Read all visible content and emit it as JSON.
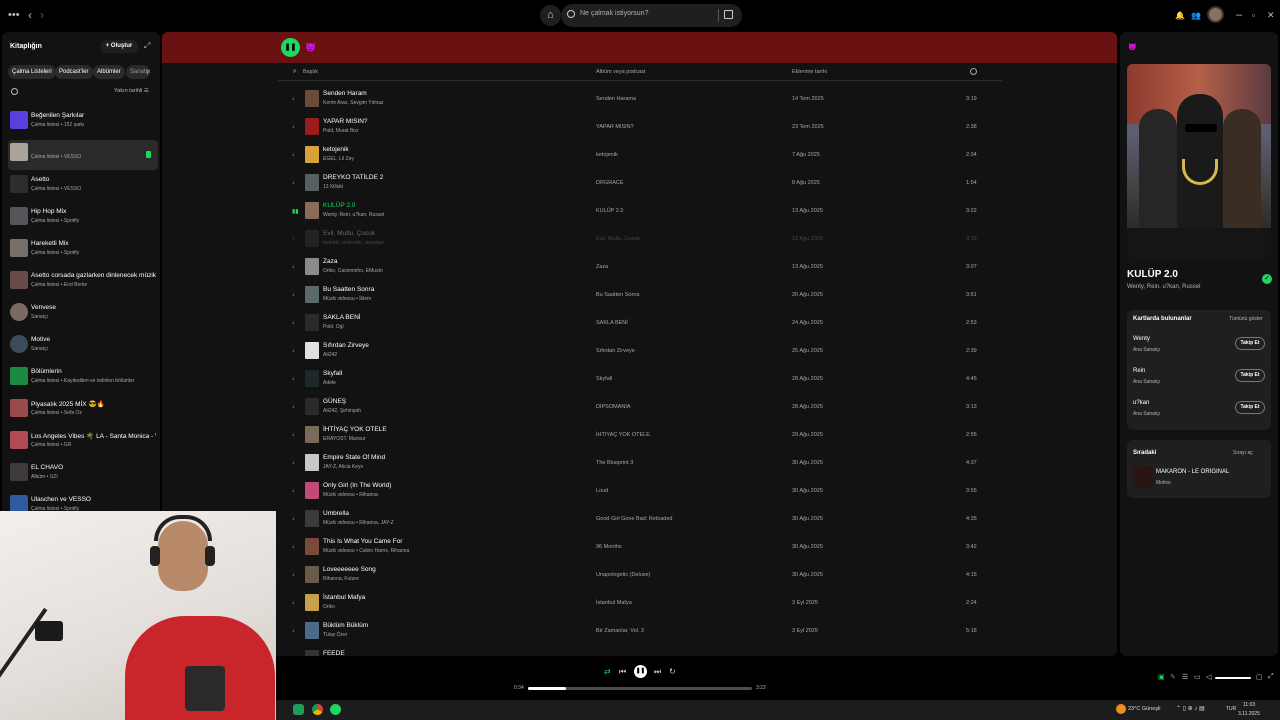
{
  "window": {
    "search_placeholder": "Ne çalmak istiyorsun?"
  },
  "colors": {
    "accent": "#1ed760",
    "header_bg": "#6a1111",
    "panel_bg": "#121212"
  },
  "library": {
    "title": "Kitaplığın",
    "create_label": "Oluştur",
    "filters": [
      "Çalma Listeleri",
      "Podcast'ler",
      "Albümler",
      "Sanatçılar"
    ],
    "sort_label": "Yakın tarihli",
    "items": [
      {
        "name": "Beğenilen Şarkılar",
        "sub": "Çalma listesi • 152 şarkı",
        "color": "#5a3ee0"
      },
      {
        "name": "",
        "sub": "Çalma listesi • VESSO",
        "color": "#a9a39c"
      },
      {
        "name": "Asetto",
        "sub": "Çalma listesi • VESSO",
        "color": "#2d2d2d"
      },
      {
        "name": "Hip Hop Mix",
        "sub": "Çalma listesi • Spotify",
        "color": "#55555a"
      },
      {
        "name": "Hareketli Mix",
        "sub": "Çalma listesi • Spotify",
        "color": "#77706a"
      },
      {
        "name": "Asetto corsada gazlarken dinlenecek müzik...",
        "sub": "Çalma listesi • Erol Berke",
        "color": "#6a4b4b"
      },
      {
        "name": "Venvese",
        "sub": "Sanatçı",
        "color": "#7a6a60"
      },
      {
        "name": "Motive",
        "sub": "Sanatçı",
        "color": "#3b4b5a"
      },
      {
        "name": "Bölümlerin",
        "sub": "Çalma listesi • Kaydedilen ve indirilen bölümler",
        "color": "#1d8a44"
      },
      {
        "name": "Piyasalık 2025 MİX 😎🔥",
        "sub": "Çalma listesi • Sefa Öz",
        "color": "#9a4a4a"
      },
      {
        "name": "Los Angeles Vibes 🌴 LA - Santa Monica - V...",
        "sub": "Çalma listesi • GR",
        "color": "#b04a55"
      },
      {
        "name": "EL CHAVO",
        "sub": "Albüm • UZI",
        "color": "#3e3a3a"
      },
      {
        "name": "Ulaschen ve VESSO",
        "sub": "Çalma listesi • Spotify",
        "color": "#2f5aa0"
      }
    ]
  },
  "playlist": {
    "columns": {
      "num": "#",
      "title": "Başlık",
      "album": "Albüm veya podcast",
      "date": "Eklenme tarihi"
    },
    "rows": [
      {
        "num": "",
        "title": "Senden Haram",
        "artist": "Kerim Araz, Sevgim Yılmaz",
        "album": "Senden Harama",
        "date": "14 Tem 2025",
        "dur": "3:19",
        "color": "#6a4a3a"
      },
      {
        "num": "",
        "title": "YAPAR MISIN?",
        "artist": "Pold, Murat Boz",
        "album": "YAPAR MISIN?",
        "date": "23 Tem 2025",
        "dur": "2:38",
        "color": "#9c1c1c"
      },
      {
        "num": "",
        "title": "ketojenik",
        "artist": "EGEL, Lil Zey",
        "album": "ketojenik",
        "date": "7 Ağu 2025",
        "dur": "2:34",
        "color": "#d6a23a"
      },
      {
        "num": "",
        "title": "DREYKO TATİLDE 2",
        "artist": "13 Killoki",
        "album": "DRGRACE",
        "date": "8 Ağu 2025",
        "dur": "1:54",
        "color": "#556060"
      },
      {
        "num": "",
        "title": "KULÜP 2.0",
        "artist": "Wenty, Rein, u?kan, Russel",
        "album": "KULÜP 2.0",
        "date": "13 Ağu 2025",
        "dur": "3:22",
        "color": "#8a6a5a"
      },
      {
        "num": "",
        "title": "Evli, Mutlu, Çocuk",
        "artist": "Indoots, emilcodc, viscalaw",
        "album": "Evli, Mutlu, Çocuk",
        "date": "13 Ağu 2025",
        "dur": "3:13",
        "color": "#444"
      },
      {
        "num": "",
        "title": "Zaza",
        "artist": "Oriko, Casinmirho, EMusto",
        "album": "Zaza",
        "date": "13 Ağu 2025",
        "dur": "3:07",
        "color": "#8a8a8a"
      },
      {
        "num": "",
        "title": "Bu Saatten Sonra",
        "artist": "Müzik videosu • İklem",
        "album": "Bu Saatten Sonra",
        "date": "20 Ağu 2025",
        "dur": "3:51",
        "color": "#5a6a6a"
      },
      {
        "num": "",
        "title": "SAKLA BENİ",
        "artist": "Pold, Ogl",
        "album": "SAKLA BENİ",
        "date": "24 Ağu 2025",
        "dur": "2:53",
        "color": "#2a2a2a"
      },
      {
        "num": "",
        "title": "Sıfırdan Zirveye",
        "artist": "Ati242",
        "album": "Sıfırdan Zirveye",
        "date": "25 Ağu 2025",
        "dur": "2:39",
        "color": "#e0e0e0"
      },
      {
        "num": "",
        "title": "Skyfall",
        "artist": "Adele",
        "album": "Skyfall",
        "date": "28 Ağu 2025",
        "dur": "4:45",
        "color": "#1e2a2a"
      },
      {
        "num": "",
        "title": "GÜNEŞ",
        "artist": "Ati242, Şehinşah",
        "album": "DIPSOMANIA",
        "date": "28 Ağu 2025",
        "dur": "3:13",
        "color": "#2a2a2a"
      },
      {
        "num": "",
        "title": "İHTİYAÇ YOK OTELE",
        "artist": "ERAYOST, Mansur",
        "album": "İHTİYAÇ YOK OTELE",
        "date": "29 Ağu 2025",
        "dur": "2:55",
        "color": "#7a6a5a"
      },
      {
        "num": "",
        "title": "Empire State Of Mind",
        "artist": "JAY-Z, Alicia Keys",
        "album": "The Blueprint 3",
        "date": "30 Ağu 2025",
        "dur": "4:37",
        "color": "#c8c8c8"
      },
      {
        "num": "",
        "title": "Only Girl (In The World)",
        "artist": "Müzik videosu • Rihanna",
        "album": "Loud",
        "date": "30 Ağu 2025",
        "dur": "3:55",
        "color": "#c04a7a"
      },
      {
        "num": "",
        "title": "Umbrella",
        "artist": "Müzik videosu • Rihanna, JAY-Z",
        "album": "Good Girl Gone Bad: Reloaded",
        "date": "30 Ağu 2025",
        "dur": "4:35",
        "color": "#3a3a3a"
      },
      {
        "num": "",
        "title": "This Is What You Came For",
        "artist": "Müzik videosu • Calvin Harris, Rihanna",
        "album": "96 Months",
        "date": "30 Ağu 2025",
        "dur": "3:42",
        "color": "#7a4a3a"
      },
      {
        "num": "",
        "title": "Loveeeeeee Song",
        "artist": "Rihanna, Future",
        "album": "Unapologetic (Deluxe)",
        "date": "30 Ağu 2025",
        "dur": "4:15",
        "color": "#6a5a4a"
      },
      {
        "num": "",
        "title": "İstanbul Mafya",
        "artist": "Oriko",
        "album": "İstanbul Mafya",
        "date": "3 Eyl 2025",
        "dur": "2:24",
        "color": "#c9a047"
      },
      {
        "num": "",
        "title": "Büklüm Büklüm",
        "artist": "Tülay Özer",
        "album": "Bir Zamanlar, Vol. 3",
        "date": "3 Eyl 2025",
        "dur": "5:18",
        "color": "#4a6a8a"
      },
      {
        "num": "",
        "title": "FEEDE",
        "artist": "",
        "album": "",
        "date": "",
        "dur": "",
        "color": "#333"
      }
    ]
  },
  "now_playing": {
    "title": "KULÜP 2.0",
    "artists": "Wenty, Rein, u?kan, Russel",
    "credits_title": "Kartlarda bulunanlar",
    "show_all": "Tümünü göster",
    "credits": [
      {
        "name": "Wenty",
        "role": "Ana Sanatçı",
        "button": "Takip Et"
      },
      {
        "name": "Rein",
        "role": "Ana Sanatçı",
        "button": "Takip Et"
      },
      {
        "name": "u?kan",
        "role": "Ana Sanatçı",
        "button": "Takip Et"
      }
    ],
    "next_title": "Sıradaki",
    "next_link": "Sırayı aç",
    "next_song": "MAKARON - LE ORIGINAL",
    "next_artist": "Motive"
  },
  "player": {
    "elapsed": "0:34",
    "total": "3:22",
    "progress": 0.17
  },
  "taskbar": {
    "weather": "23°C Güneşli",
    "lang": "TUR",
    "time": "11:03",
    "date": "3.11.2025"
  }
}
